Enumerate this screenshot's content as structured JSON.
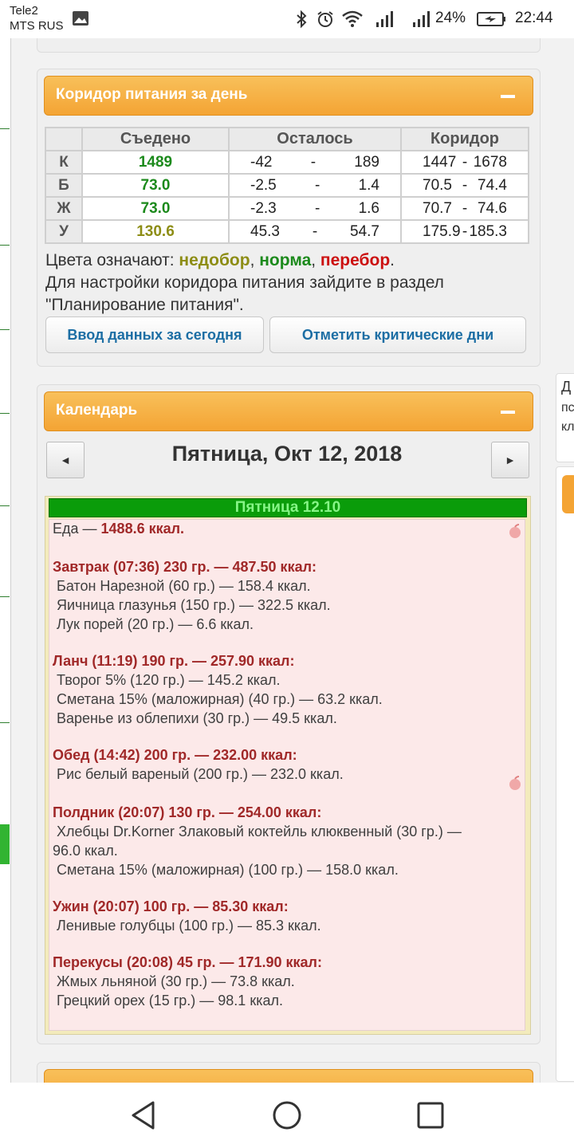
{
  "status_bar": {
    "carrier_1": "Tele2",
    "carrier_2": "MTS RUS",
    "battery": "24%",
    "time": "22:44"
  },
  "nutrition_panel": {
    "title": "Коридор питания за день",
    "columns": [
      "Съедено",
      "Осталось",
      "Коридор"
    ],
    "rows": [
      {
        "label": "К",
        "eaten": "1489",
        "left_min": "-42",
        "left_max": "189",
        "range_min": "1447",
        "range_max": "1678"
      },
      {
        "label": "Б",
        "eaten": "73.0",
        "left_min": "-2.5",
        "left_max": "1.4",
        "range_min": "70.5",
        "range_max": "74.4"
      },
      {
        "label": "Ж",
        "eaten": "73.0",
        "left_min": "-2.3",
        "left_max": "1.6",
        "range_min": "70.7",
        "range_max": "74.6"
      },
      {
        "label": "У",
        "eaten": "130.6",
        "left_min": "45.3",
        "left_max": "54.7",
        "range_min": "175.9",
        "range_max": "185.3"
      }
    ],
    "dash": "-",
    "legend": {
      "prefix": "Цвета означают: ",
      "under": "недобор",
      "sep1": ", ",
      "normal": "норма",
      "sep2": ", ",
      "over": "перебор",
      "suffix": ".",
      "colors": {
        "under": "#8d8d15",
        "normal": "#1c8a1c",
        "over": "#cc1111"
      }
    },
    "note_line1": "Для настройки коридора питания зайдите в раздел",
    "note_line2": "\"Планирование питания\".",
    "btn_input": "Ввод данных за сегодня",
    "btn_critical": "Отметить критические дни"
  },
  "calendar_panel": {
    "title": "Календарь",
    "date": "Пятница, Окт 12, 2018",
    "day_bar": "Пятница 12.10",
    "food_total_prefix": "Еда — ",
    "food_total": "1488.6 ккал.",
    "lines": [
      {
        "type": "meal",
        "text": "Завтрак (07:36) 230 гр. — 487.50 ккал:"
      },
      {
        "type": "item",
        "text": "Батон Нарезной (60 гр.) — 158.4 ккал."
      },
      {
        "type": "item",
        "text": "Яичница глазунья (150 гр.) — 322.5 ккал."
      },
      {
        "type": "item",
        "text": "Лук порей (20 гр.) — 6.6 ккал."
      },
      {
        "type": "meal",
        "text": "Ланч (11:19) 190 гр. — 257.90 ккал:"
      },
      {
        "type": "item",
        "text": "Творог 5% (120 гр.) — 145.2 ккал."
      },
      {
        "type": "item",
        "text": "Сметана 15% (маложирная) (40 гр.) — 63.2 ккал."
      },
      {
        "type": "item",
        "text": "Варенье из облепихи (30 гр.) — 49.5 ккал."
      },
      {
        "type": "meal",
        "text": "Обед (14:42) 200 гр. — 232.00 ккал:"
      },
      {
        "type": "item",
        "text": "Рис белый вареный (200 гр.) — 232.0 ккал."
      },
      {
        "type": "meal",
        "text": "Полдник (20:07) 130 гр. — 254.00 ккал:"
      },
      {
        "type": "item",
        "text": "Хлебцы Dr.Korner Злаковый коктейль клюквенный (30 гр.) —"
      },
      {
        "type": "cont",
        "text": "96.0 ккал."
      },
      {
        "type": "item",
        "text": "Сметана 15% (маложирная) (100 гр.) — 158.0 ккал."
      },
      {
        "type": "meal",
        "text": "Ужин (20:07) 100 гр. — 85.30 ккал:"
      },
      {
        "type": "item",
        "text": "Ленивые голубцы (100 гр.) — 85.3 ккал."
      },
      {
        "type": "meal",
        "text": "Перекусы (20:08) 45 гр. — 171.90 ккал:"
      },
      {
        "type": "item",
        "text": "Жмых льняной (30 гр.) — 73.8 ккал."
      },
      {
        "type": "item",
        "text": "Грецкий орех (15 гр.) — 98.1 ккал."
      }
    ]
  },
  "right_panel_partial": {
    "line1": "Д",
    "line2": "пс",
    "line3": "кл"
  }
}
